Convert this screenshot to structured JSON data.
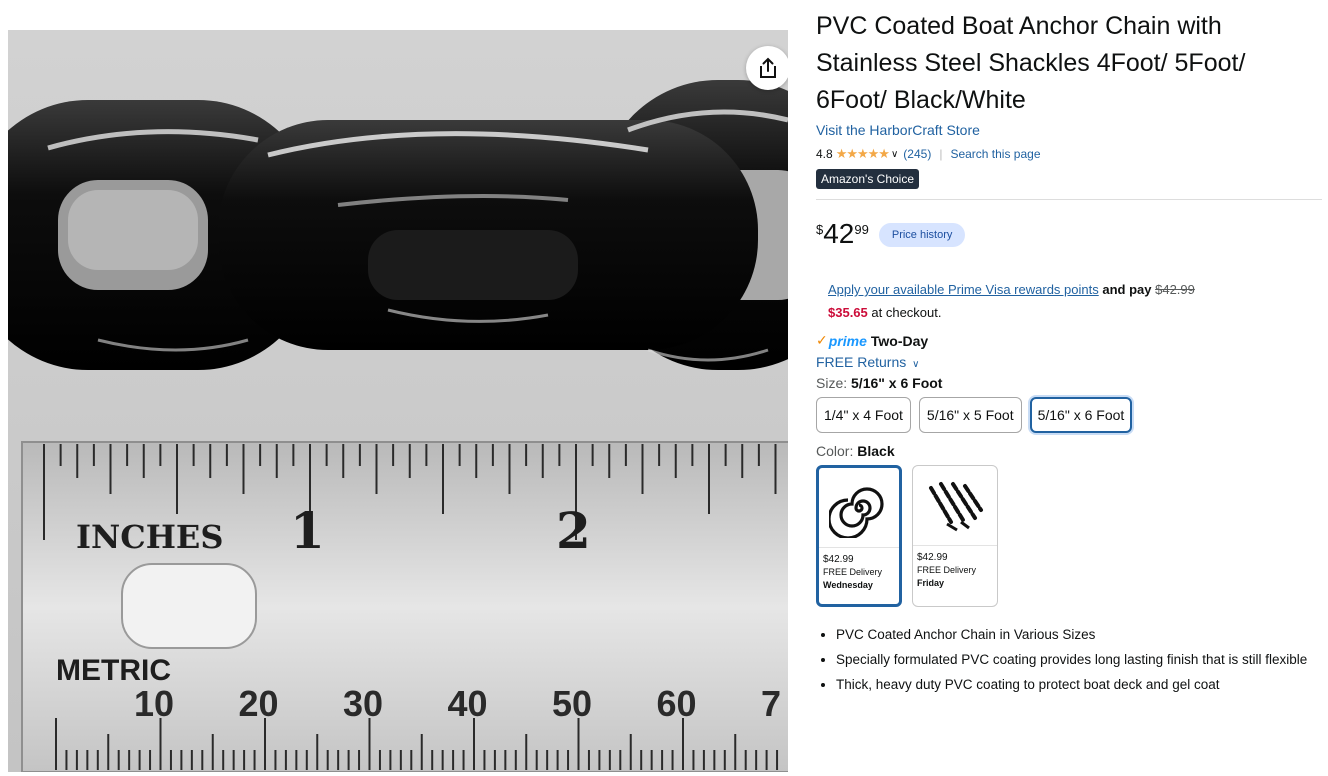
{
  "product": {
    "title": "PVC Coated Boat Anchor Chain with Stainless Steel Shackles 4Foot/ 5Foot/ 6Foot/ Black/White",
    "store_link": "Visit the HarborCraft Store",
    "rating": "4.8",
    "review_count": "(245)",
    "search_link": "Search this page",
    "badge": "Amazon's Choice"
  },
  "price": {
    "symbol": "$",
    "whole": "42",
    "fraction": "99",
    "history_label": "Price history"
  },
  "promo": {
    "link_text": "Apply your available Prime Visa rewards points",
    "and_pay": "and pay",
    "original": "$42.99",
    "discounted": "$35.65",
    "suffix": "at checkout."
  },
  "delivery": {
    "prime_label": "prime",
    "speed": "Two-Day",
    "returns": "FREE Returns"
  },
  "size": {
    "label": "Size:",
    "selected": "5/16\" x 6 Foot",
    "options": [
      "1/4\" x 4 Foot",
      "5/16\" x 5 Foot",
      "5/16\" x 6 Foot"
    ]
  },
  "color": {
    "label": "Color:",
    "selected": "Black",
    "options": [
      {
        "price": "$42.99",
        "delivery": "FREE Delivery",
        "day": "Wednesday"
      },
      {
        "price": "$42.99",
        "delivery": "FREE Delivery",
        "day": "Friday"
      }
    ]
  },
  "bullets": [
    "PVC Coated Anchor Chain in Various Sizes",
    "Specially formulated PVC coating provides long lasting finish that is still flexible",
    "Thick, heavy duty PVC coating to protect boat deck and gel coat"
  ],
  "ruler": {
    "inches_label": "INCHES",
    "inch_numbers": [
      "1",
      "2"
    ],
    "metric_label": "METRIC",
    "metric_numbers": [
      "10",
      "20",
      "30",
      "40",
      "50",
      "60",
      "7"
    ]
  },
  "colors": {
    "link": "#2162a1",
    "price_red": "#cc0c39",
    "badge_bg": "#232f3e",
    "prime_blue": "#1a98ff",
    "selected_border": "#2162a1"
  }
}
